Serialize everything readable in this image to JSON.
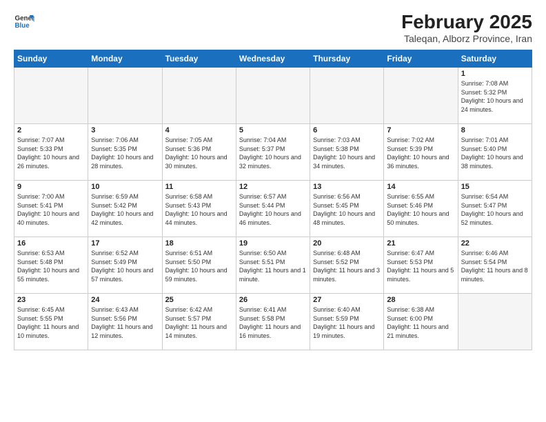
{
  "logo": {
    "line1": "General",
    "line2": "Blue"
  },
  "title": "February 2025",
  "subtitle": "Taleqan, Alborz Province, Iran",
  "days_of_week": [
    "Sunday",
    "Monday",
    "Tuesday",
    "Wednesday",
    "Thursday",
    "Friday",
    "Saturday"
  ],
  "weeks": [
    [
      {
        "day": "",
        "empty": true
      },
      {
        "day": "",
        "empty": true
      },
      {
        "day": "",
        "empty": true
      },
      {
        "day": "",
        "empty": true
      },
      {
        "day": "",
        "empty": true
      },
      {
        "day": "",
        "empty": true
      },
      {
        "day": "1",
        "sunrise": "7:08 AM",
        "sunset": "5:32 PM",
        "daylight": "10 hours and 24 minutes."
      }
    ],
    [
      {
        "day": "2",
        "sunrise": "7:07 AM",
        "sunset": "5:33 PM",
        "daylight": "10 hours and 26 minutes."
      },
      {
        "day": "3",
        "sunrise": "7:06 AM",
        "sunset": "5:35 PM",
        "daylight": "10 hours and 28 minutes."
      },
      {
        "day": "4",
        "sunrise": "7:05 AM",
        "sunset": "5:36 PM",
        "daylight": "10 hours and 30 minutes."
      },
      {
        "day": "5",
        "sunrise": "7:04 AM",
        "sunset": "5:37 PM",
        "daylight": "10 hours and 32 minutes."
      },
      {
        "day": "6",
        "sunrise": "7:03 AM",
        "sunset": "5:38 PM",
        "daylight": "10 hours and 34 minutes."
      },
      {
        "day": "7",
        "sunrise": "7:02 AM",
        "sunset": "5:39 PM",
        "daylight": "10 hours and 36 minutes."
      },
      {
        "day": "8",
        "sunrise": "7:01 AM",
        "sunset": "5:40 PM",
        "daylight": "10 hours and 38 minutes."
      }
    ],
    [
      {
        "day": "9",
        "sunrise": "7:00 AM",
        "sunset": "5:41 PM",
        "daylight": "10 hours and 40 minutes."
      },
      {
        "day": "10",
        "sunrise": "6:59 AM",
        "sunset": "5:42 PM",
        "daylight": "10 hours and 42 minutes."
      },
      {
        "day": "11",
        "sunrise": "6:58 AM",
        "sunset": "5:43 PM",
        "daylight": "10 hours and 44 minutes."
      },
      {
        "day": "12",
        "sunrise": "6:57 AM",
        "sunset": "5:44 PM",
        "daylight": "10 hours and 46 minutes."
      },
      {
        "day": "13",
        "sunrise": "6:56 AM",
        "sunset": "5:45 PM",
        "daylight": "10 hours and 48 minutes."
      },
      {
        "day": "14",
        "sunrise": "6:55 AM",
        "sunset": "5:46 PM",
        "daylight": "10 hours and 50 minutes."
      },
      {
        "day": "15",
        "sunrise": "6:54 AM",
        "sunset": "5:47 PM",
        "daylight": "10 hours and 52 minutes."
      }
    ],
    [
      {
        "day": "16",
        "sunrise": "6:53 AM",
        "sunset": "5:48 PM",
        "daylight": "10 hours and 55 minutes."
      },
      {
        "day": "17",
        "sunrise": "6:52 AM",
        "sunset": "5:49 PM",
        "daylight": "10 hours and 57 minutes."
      },
      {
        "day": "18",
        "sunrise": "6:51 AM",
        "sunset": "5:50 PM",
        "daylight": "10 hours and 59 minutes."
      },
      {
        "day": "19",
        "sunrise": "6:50 AM",
        "sunset": "5:51 PM",
        "daylight": "11 hours and 1 minute."
      },
      {
        "day": "20",
        "sunrise": "6:48 AM",
        "sunset": "5:52 PM",
        "daylight": "11 hours and 3 minutes."
      },
      {
        "day": "21",
        "sunrise": "6:47 AM",
        "sunset": "5:53 PM",
        "daylight": "11 hours and 5 minutes."
      },
      {
        "day": "22",
        "sunrise": "6:46 AM",
        "sunset": "5:54 PM",
        "daylight": "11 hours and 8 minutes."
      }
    ],
    [
      {
        "day": "23",
        "sunrise": "6:45 AM",
        "sunset": "5:55 PM",
        "daylight": "11 hours and 10 minutes."
      },
      {
        "day": "24",
        "sunrise": "6:43 AM",
        "sunset": "5:56 PM",
        "daylight": "11 hours and 12 minutes."
      },
      {
        "day": "25",
        "sunrise": "6:42 AM",
        "sunset": "5:57 PM",
        "daylight": "11 hours and 14 minutes."
      },
      {
        "day": "26",
        "sunrise": "6:41 AM",
        "sunset": "5:58 PM",
        "daylight": "11 hours and 16 minutes."
      },
      {
        "day": "27",
        "sunrise": "6:40 AM",
        "sunset": "5:59 PM",
        "daylight": "11 hours and 19 minutes."
      },
      {
        "day": "28",
        "sunrise": "6:38 AM",
        "sunset": "6:00 PM",
        "daylight": "11 hours and 21 minutes."
      },
      {
        "day": "",
        "empty": true
      }
    ]
  ]
}
